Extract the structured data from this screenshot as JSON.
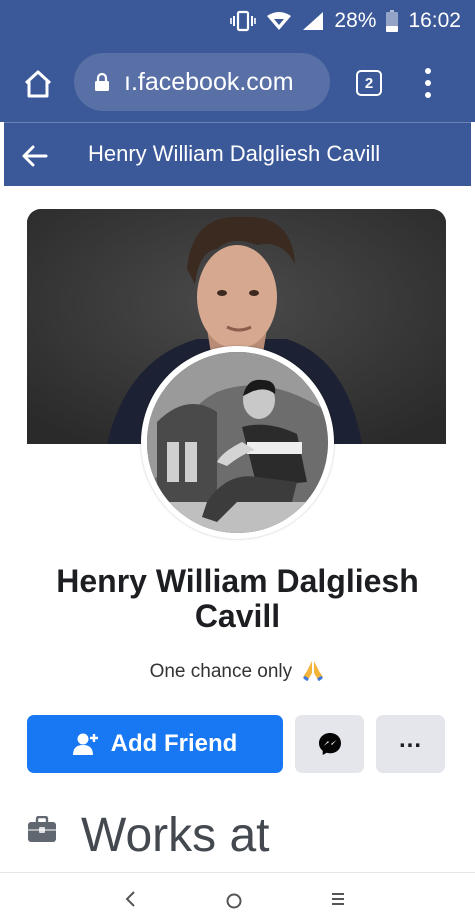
{
  "status_bar": {
    "battery": "28%",
    "time": "16:02"
  },
  "browser": {
    "url": "ı.facebook.com",
    "tab_count": "2"
  },
  "header": {
    "title": "Henry William Dalgliesh Cavill"
  },
  "profile": {
    "name": "Henry William Dalgliesh Cavill",
    "bio": "One chance only"
  },
  "actions": {
    "add_friend": "Add Friend"
  },
  "section": {
    "works_at": "Works at"
  },
  "icons": {
    "home": "home-icon",
    "lock": "lock-icon",
    "back": "arrow-left-icon",
    "messenger": "messenger-icon",
    "more": "more-horizontal-icon",
    "briefcase": "briefcase-icon",
    "add_person": "add-person-icon",
    "pray": "folded-hands-emoji"
  },
  "colors": {
    "header_bg": "#3b5998",
    "primary_button": "#1877f2",
    "secondary_button": "#e4e6eb"
  }
}
